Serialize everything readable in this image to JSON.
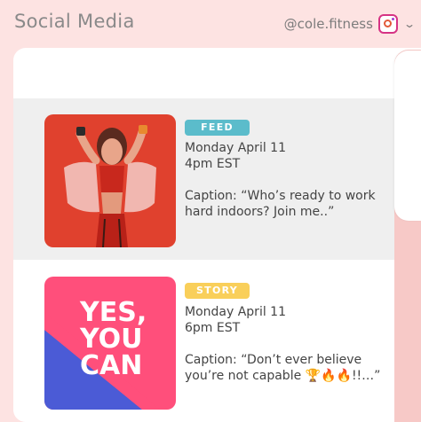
{
  "header": {
    "title": "Social Media",
    "account_handle": "@cole.fitness"
  },
  "posts": [
    {
      "type": "FEED",
      "type_color": "#5bbccb",
      "date": "Monday April 11",
      "time": "4pm EST",
      "caption": "Caption: “Who’s ready to work hard indoors? Join me..”",
      "selected": true
    },
    {
      "type": "STORY",
      "type_color": "#f9cf5a",
      "date": "Monday April 11",
      "time": "6pm EST",
      "caption": "Caption: “Don’t ever believe you’re not capable 🏆🔥🔥!!…”",
      "image_text": [
        "YES,",
        "YOU",
        "CAN"
      ],
      "selected": false
    }
  ]
}
